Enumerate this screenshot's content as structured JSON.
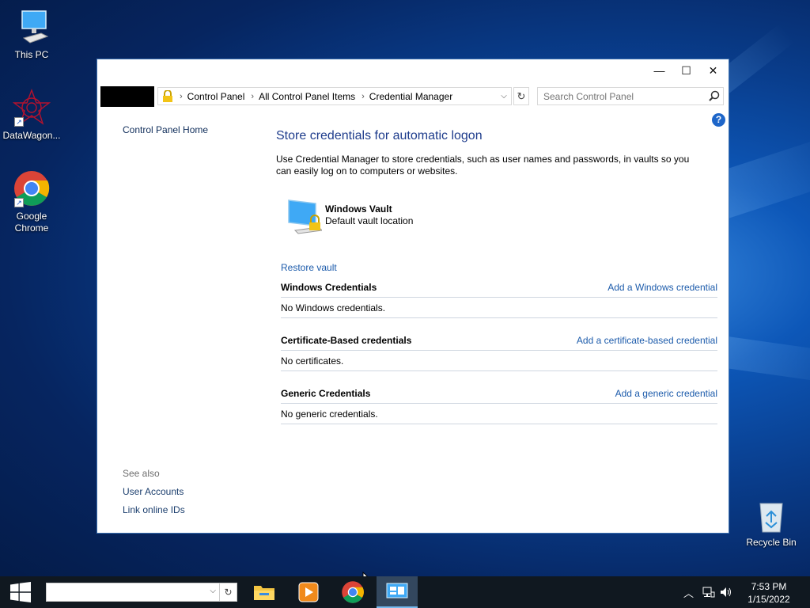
{
  "desktop": {
    "icons": [
      {
        "label": "This PC"
      },
      {
        "label": "DataWagon..."
      },
      {
        "label": "Google Chrome"
      },
      {
        "label": "Recycle Bin"
      }
    ]
  },
  "window": {
    "buttons": {
      "minimize": "—",
      "maximize": "☐",
      "close": "✕"
    },
    "breadcrumb": [
      "Control Panel",
      "All Control Panel Items",
      "Credential Manager"
    ],
    "search_placeholder": "Search Control Panel",
    "help": "?"
  },
  "leftnav": {
    "home": "Control Panel Home",
    "see_also": "See also",
    "links": [
      "User Accounts",
      "Link online IDs"
    ]
  },
  "main": {
    "heading": "Store credentials for automatic logon",
    "description": "Use Credential Manager to store credentials, such as user names and passwords, in vaults so you can easily log on to computers or websites.",
    "vault_title": "Windows Vault",
    "vault_subtitle": "Default vault location",
    "restore": "Restore vault",
    "sections": [
      {
        "title": "Windows Credentials",
        "add": "Add a Windows credential",
        "empty": "No Windows credentials."
      },
      {
        "title": "Certificate-Based credentials",
        "add": "Add a certificate-based credential",
        "empty": "No certificates."
      },
      {
        "title": "Generic Credentials",
        "add": "Add a generic credential",
        "empty": "No generic credentials."
      }
    ]
  },
  "taskbar": {
    "time": "7:53 PM",
    "date": "1/15/2022"
  },
  "colors": {
    "link": "#1c5bab",
    "heading": "#1e3c8c",
    "taskbar": "#101820"
  }
}
